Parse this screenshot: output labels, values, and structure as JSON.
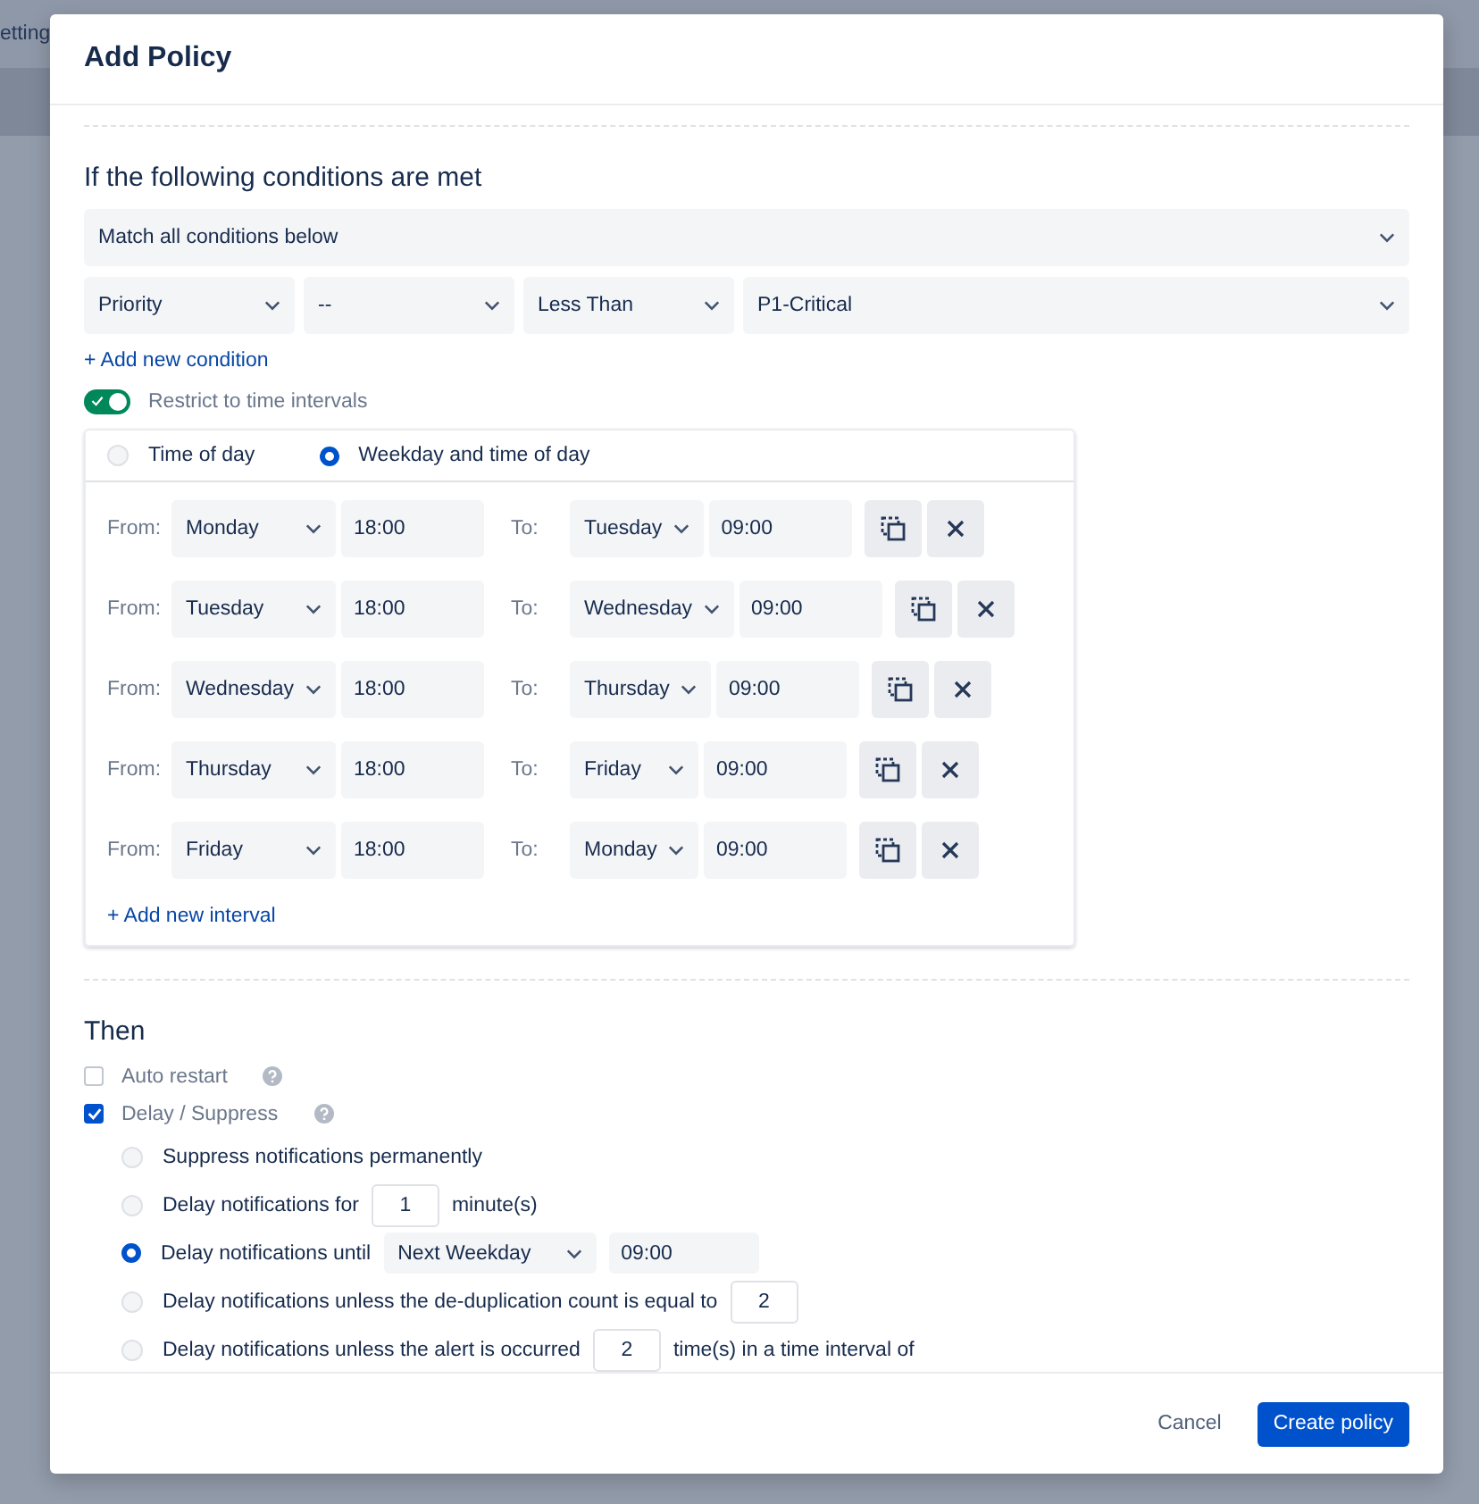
{
  "background": {
    "nav_text": "etting"
  },
  "dialog": {
    "title": "Add Policy"
  },
  "conditions": {
    "heading": "If the following conditions are met",
    "match": {
      "value": "Match all conditions below"
    },
    "rows": [
      {
        "fields": [
          {
            "value": "Priority"
          },
          {
            "value": "--"
          },
          {
            "value": "Less Than"
          },
          {
            "value": "P1-Critical"
          }
        ]
      }
    ],
    "add_link": "+ Add new condition"
  },
  "restrict": {
    "label": "Restrict to time intervals",
    "on": true
  },
  "interval_modes": [
    {
      "label": "Time of day",
      "selected": false
    },
    {
      "label": "Weekday and time of day",
      "selected": true
    }
  ],
  "intervals": [
    {
      "from_label": "From:",
      "from_day": "Monday",
      "from_time": "18:00",
      "to_label": "To:",
      "to_day": "Tuesday",
      "to_time": "09:00"
    },
    {
      "from_label": "From:",
      "from_day": "Tuesday",
      "from_time": "18:00",
      "to_label": "To:",
      "to_day": "Wednesday",
      "to_time": "09:00"
    },
    {
      "from_label": "From:",
      "from_day": "Wednesday",
      "from_time": "18:00",
      "to_label": "To:",
      "to_day": "Thursday",
      "to_time": "09:00"
    },
    {
      "from_label": "From:",
      "from_day": "Thursday",
      "from_time": "18:00",
      "to_label": "To:",
      "to_day": "Friday",
      "to_time": "09:00"
    },
    {
      "from_label": "From:",
      "from_day": "Friday",
      "from_time": "18:00",
      "to_label": "To:",
      "to_day": "Monday",
      "to_time": "09:00"
    }
  ],
  "add_interval": "+ Add new interval",
  "then": {
    "heading": "Then",
    "actions": [
      {
        "label": "Auto restart",
        "checked": false
      },
      {
        "label": "Delay / Suppress",
        "checked": true
      }
    ],
    "options": [
      {
        "selected": false,
        "parts": [
          {
            "kind": "text",
            "value": "Suppress notifications permanently"
          }
        ]
      },
      {
        "selected": false,
        "parts": [
          {
            "kind": "text",
            "value": "Delay notifications for"
          },
          {
            "kind": "number",
            "value": "1"
          },
          {
            "kind": "text",
            "value": "minute(s)"
          }
        ]
      },
      {
        "selected": true,
        "parts": [
          {
            "kind": "text",
            "value": "Delay notifications until"
          },
          {
            "kind": "select",
            "value": "Next Weekday"
          },
          {
            "kind": "time",
            "value": "09:00"
          }
        ]
      },
      {
        "selected": false,
        "parts": [
          {
            "kind": "text",
            "value": "Delay notifications unless the de-duplication count is equal to"
          },
          {
            "kind": "number",
            "value": "2"
          }
        ]
      },
      {
        "selected": false,
        "parts": [
          {
            "kind": "text",
            "value": "Delay notifications unless the alert is occurred"
          },
          {
            "kind": "number",
            "value": "2"
          },
          {
            "kind": "text",
            "value": "time(s) in a time interval of"
          }
        ]
      }
    ]
  },
  "footer": {
    "cancel": "Cancel",
    "submit": "Create policy"
  }
}
